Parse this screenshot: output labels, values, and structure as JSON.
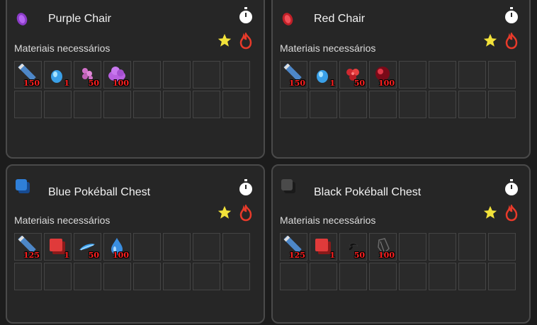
{
  "recipes": [
    {
      "title": "Purple Chair",
      "icon": "purple-chair-icon",
      "requirements_label": "Materiais necessários",
      "materials": [
        {
          "icon": "pencil-icon",
          "qty": "150"
        },
        {
          "icon": "blue-gem-icon",
          "qty": "1"
        },
        {
          "icon": "pink-flower-icon",
          "qty": "50"
        },
        {
          "icon": "purple-cloud-icon",
          "qty": "100"
        }
      ]
    },
    {
      "title": "Red Chair",
      "icon": "red-chair-icon",
      "requirements_label": "Materiais necessários",
      "materials": [
        {
          "icon": "pencil-icon",
          "qty": "150"
        },
        {
          "icon": "blue-gem-icon",
          "qty": "1"
        },
        {
          "icon": "red-flower-icon",
          "qty": "50"
        },
        {
          "icon": "dark-red-orb-icon",
          "qty": "100"
        }
      ]
    },
    {
      "title": "Blue Pokéball Chest",
      "icon": "blue-chest-icon",
      "requirements_label": "Materiais necessários",
      "materials": [
        {
          "icon": "pencil-icon",
          "qty": "125"
        },
        {
          "icon": "red-box-icon",
          "qty": "1"
        },
        {
          "icon": "blue-feather-icon",
          "qty": "50"
        },
        {
          "icon": "water-drop-icon",
          "qty": "100"
        }
      ]
    },
    {
      "title": "Black Pokéball Chest",
      "icon": "black-chest-icon",
      "requirements_label": "Materiais necessários",
      "materials": [
        {
          "icon": "pencil-icon",
          "qty": "125"
        },
        {
          "icon": "red-box-icon",
          "qty": "1"
        },
        {
          "icon": "black-claw-icon",
          "qty": "50"
        },
        {
          "icon": "dark-shard-icon",
          "qty": "100"
        }
      ]
    }
  ],
  "colors": {
    "quantity": "#ff2020",
    "star": "#f2e23a",
    "fire": "#e83a2a",
    "panel": "#262626",
    "border": "#4a4a4a"
  }
}
